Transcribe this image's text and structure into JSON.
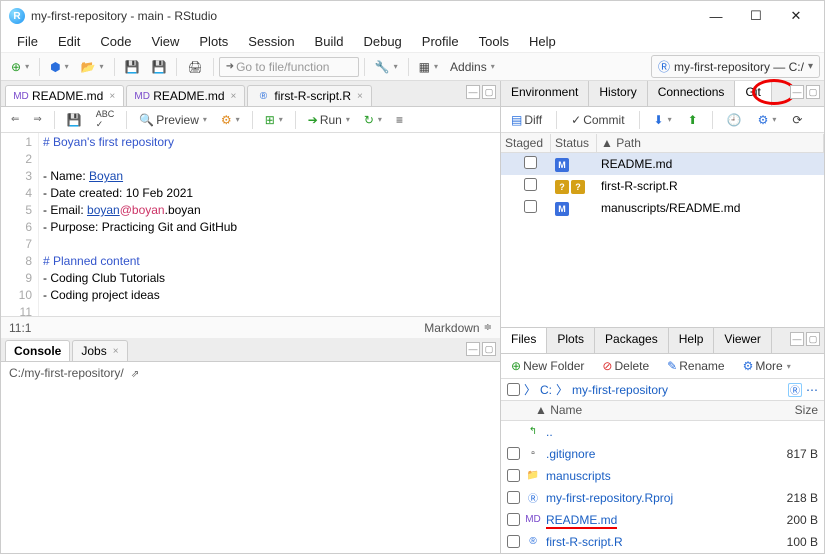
{
  "window": {
    "title": "my-first-repository - main - RStudio"
  },
  "menubar": [
    "File",
    "Edit",
    "Code",
    "View",
    "Plots",
    "Session",
    "Build",
    "Debug",
    "Profile",
    "Tools",
    "Help"
  ],
  "toolbar": {
    "goto_placeholder": "Go to file/function",
    "addins": "Addins",
    "project": "my-first-repository — C:/"
  },
  "editor": {
    "tabs": [
      {
        "icon": "MD",
        "label": "README.md",
        "active": true
      },
      {
        "icon": "MD",
        "label": "README.md",
        "active": false
      },
      {
        "icon": "R",
        "label": "first-R-script.R",
        "active": false
      }
    ],
    "toolbar": {
      "preview": "Preview",
      "run": "Run"
    },
    "lines": [
      {
        "n": 1,
        "text": "# Boyan's first repository",
        "cls": "c-blue"
      },
      {
        "n": 2,
        "text": ""
      },
      {
        "n": 3,
        "segments": [
          {
            "t": "- Name: "
          },
          {
            "t": "Boyan",
            "cls": "c-link"
          }
        ]
      },
      {
        "n": 4,
        "text": "- Date created: 10 Feb 2021"
      },
      {
        "n": 5,
        "segments": [
          {
            "t": "- Email: "
          },
          {
            "t": "boyan",
            "cls": "c-link"
          },
          {
            "t": "@boyan",
            "cls": "c-red"
          },
          {
            "t": ".boyan"
          }
        ]
      },
      {
        "n": 6,
        "text": "- Purpose: Practicing Git and GitHub"
      },
      {
        "n": 7,
        "text": ""
      },
      {
        "n": 8,
        "text": "# Planned content",
        "cls": "c-blue"
      },
      {
        "n": 9,
        "text": "- Coding Club Tutorials"
      },
      {
        "n": 10,
        "text": "- Coding project ideas"
      },
      {
        "n": 11,
        "text": ""
      }
    ],
    "status": {
      "pos": "11:1",
      "type": "Markdown"
    }
  },
  "console": {
    "tabs": [
      "Console",
      "Jobs"
    ],
    "path": "C:/my-first-repository/"
  },
  "env_tabs": [
    "Environment",
    "History",
    "Connections",
    "Git"
  ],
  "git": {
    "toolbar": {
      "diff": "Diff",
      "commit": "Commit"
    },
    "columns": [
      "Staged",
      "Status",
      "Path"
    ],
    "rows": [
      {
        "status": "M",
        "badge": "b-m",
        "path": "README.md",
        "sel": true
      },
      {
        "status": "??",
        "badge": "b-q",
        "path": "first-R-script.R"
      },
      {
        "status": "M",
        "badge": "b-m",
        "path": "manuscripts/README.md"
      }
    ]
  },
  "files_tabs": [
    "Files",
    "Plots",
    "Packages",
    "Help",
    "Viewer"
  ],
  "files": {
    "toolbar": {
      "new": "New Folder",
      "delete": "Delete",
      "rename": "Rename",
      "more": "More"
    },
    "crumb": [
      "C:",
      "my-first-repository"
    ],
    "columns": {
      "name": "Name",
      "size": "Size"
    },
    "rows": [
      {
        "icon": "up",
        "name": "..",
        "size": ""
      },
      {
        "icon": "file",
        "name": ".gitignore",
        "size": "817 B"
      },
      {
        "icon": "folder",
        "name": "manuscripts",
        "size": ""
      },
      {
        "icon": "rproj",
        "name": "my-first-repository.Rproj",
        "size": "218 B"
      },
      {
        "icon": "md",
        "name": "README.md",
        "size": "200 B",
        "highlight": true
      },
      {
        "icon": "r",
        "name": "first-R-script.R",
        "size": "100 B"
      }
    ]
  }
}
